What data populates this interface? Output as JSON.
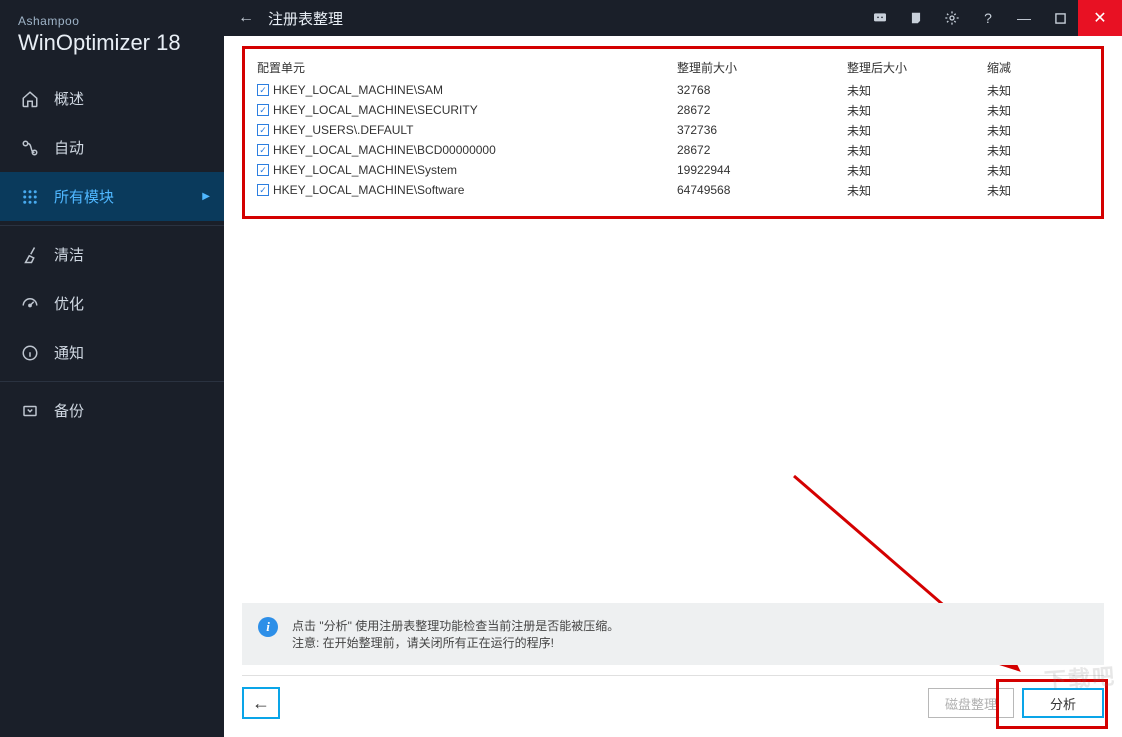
{
  "brand": "Ashampoo",
  "product": "WinOptimizer",
  "version": "18",
  "titlebar": {
    "title": "注册表整理"
  },
  "sidebar": {
    "items": [
      {
        "label": "概述",
        "icon": "home"
      },
      {
        "label": "自动",
        "icon": "auto"
      },
      {
        "label": "所有模块",
        "icon": "grid",
        "active": true
      },
      {
        "label": "清洁",
        "icon": "broom"
      },
      {
        "label": "优化",
        "icon": "gauge"
      },
      {
        "label": "通知",
        "icon": "info"
      },
      {
        "label": "备份",
        "icon": "backup"
      }
    ]
  },
  "table": {
    "headers": [
      "配置单元",
      "整理前大小",
      "整理后大小",
      "缩减"
    ],
    "rows": [
      {
        "name": "HKEY_LOCAL_MACHINE\\SAM",
        "before": "32768",
        "after": "未知",
        "reduce": "未知"
      },
      {
        "name": "HKEY_LOCAL_MACHINE\\SECURITY",
        "before": "28672",
        "after": "未知",
        "reduce": "未知"
      },
      {
        "name": "HKEY_USERS\\.DEFAULT",
        "before": "372736",
        "after": "未知",
        "reduce": "未知"
      },
      {
        "name": "HKEY_LOCAL_MACHINE\\BCD00000000",
        "before": "28672",
        "after": "未知",
        "reduce": "未知"
      },
      {
        "name": "HKEY_LOCAL_MACHINE\\System",
        "before": "19922944",
        "after": "未知",
        "reduce": "未知"
      },
      {
        "name": "HKEY_LOCAL_MACHINE\\Software",
        "before": "64749568",
        "after": "未知",
        "reduce": "未知"
      }
    ]
  },
  "info": {
    "line1": "点击 \"分析\" 使用注册表整理功能检查当前注册是否能被压缩。",
    "line2": "注意: 在开始整理前，请关闭所有正在运行的程序!"
  },
  "buttons": {
    "defrag": "磁盘整理",
    "analyze": "分析"
  },
  "watermark": "下载吧"
}
